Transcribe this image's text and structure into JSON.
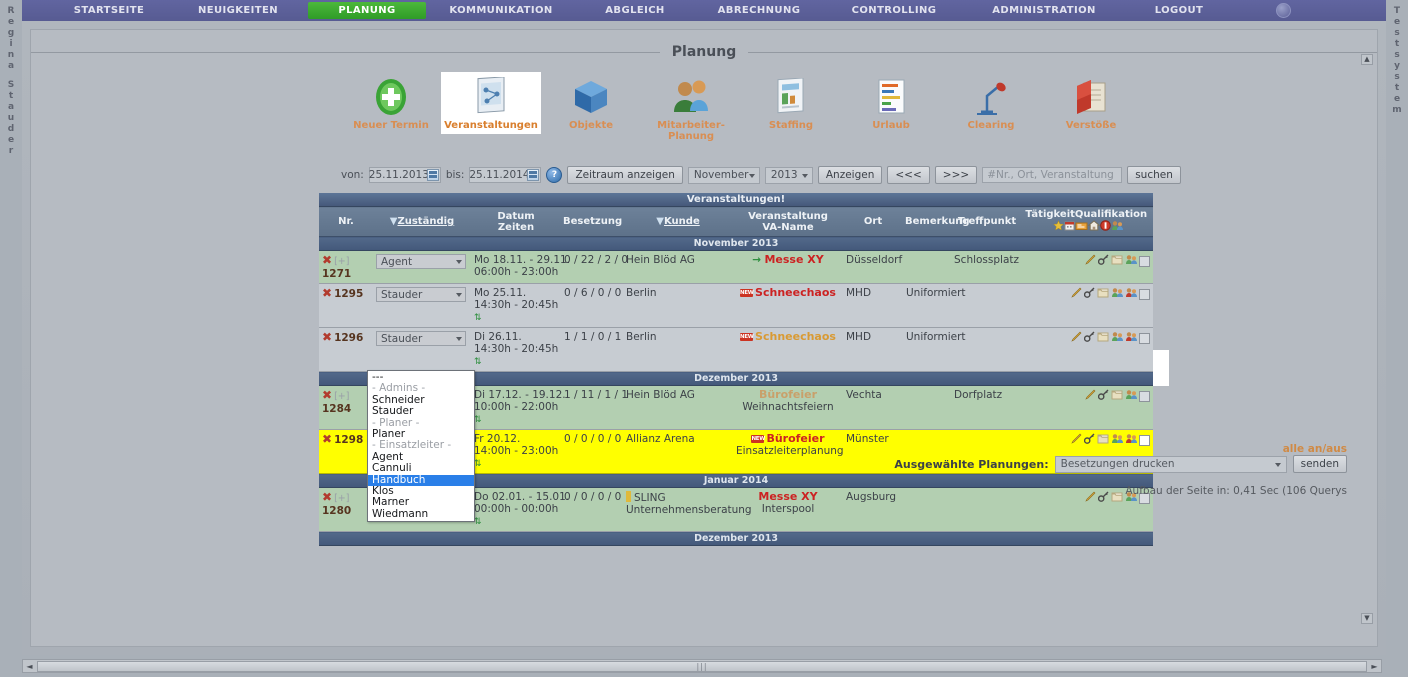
{
  "user_strip": "Regina Stauder",
  "system_strip": "Testsystem",
  "nav": {
    "items": [
      {
        "label": "STARTSEITE",
        "active": false
      },
      {
        "label": "NEUIGKEITEN",
        "active": false
      },
      {
        "label": "PLANUNG",
        "active": true
      },
      {
        "label": "KOMMUNIKATION",
        "active": false
      },
      {
        "label": "ABGLEICH",
        "active": false
      },
      {
        "label": "ABRECHNUNG",
        "active": false
      },
      {
        "label": "CONTROLLING",
        "active": false
      },
      {
        "label": "ADMINISTRATION",
        "active": false
      },
      {
        "label": "LOGOUT",
        "active": false
      }
    ]
  },
  "section": {
    "title": "Planung"
  },
  "toolbar": {
    "items": [
      {
        "label": "Neuer Termin",
        "icon": "green-plus-icon",
        "selected": false
      },
      {
        "label": "Veranstaltungen",
        "icon": "clipboard-chart-icon",
        "selected": true
      },
      {
        "label": "Objekte",
        "icon": "blue-cube-icon",
        "selected": false
      },
      {
        "label": "Mitarbeiter-Planung",
        "icon": "two-people-icon",
        "selected": false
      },
      {
        "label": "Staffing",
        "icon": "document-list-icon",
        "selected": false
      },
      {
        "label": "Urlaub",
        "icon": "gantt-bars-icon",
        "selected": false
      },
      {
        "label": "Clearing",
        "icon": "desk-lamp-icon",
        "selected": false
      },
      {
        "label": "Verstöße",
        "icon": "red-folder-icon",
        "selected": false
      }
    ]
  },
  "filters": {
    "von_label": "von:",
    "von_value": "25.11.2013",
    "bis_label": "bis:",
    "bis_value": "25.11.2014",
    "help_glyph": "?",
    "zeitraum_button": "Zeitraum anzeigen",
    "month_value": "November",
    "year_value": "2013",
    "anzeigen_button": "Anzeigen",
    "prev_button": "<<<",
    "next_button": ">>>",
    "search_placeholder": "#Nr., Ort, Veranstaltung",
    "search_value": "",
    "search_button": "suchen"
  },
  "table": {
    "title": "Veranstaltungen!",
    "columns": {
      "nr": "Nr.",
      "zustaendig": "Zuständig",
      "datum": "Datum",
      "zeiten": "Zeiten",
      "besetzung": "Besetzung",
      "kunde": "Kunde",
      "veranstaltung": "Veranstaltung",
      "va_name": "VA-Name",
      "ort": "Ort",
      "bemerkung": "Bemerkung",
      "treffpunkt": "Treffpunkt",
      "taetigkeit": "Tätigkeit",
      "qualifikation": "Qualifikation"
    },
    "header_icons": [
      "star-icon",
      "calendar-icon",
      "card-icon",
      "home-icon",
      "warning-icon",
      "people-icon"
    ],
    "groups": [
      {
        "month": "November 2013",
        "rows": [
          {
            "tone": "green",
            "expand": "[+]",
            "nr": "1271",
            "zustaendig": "Agent",
            "datum": "Mo 18.11. - 29.11.",
            "zeiten": "06:00h - 23:00h",
            "besetzung": "0 / 22 / 2 / 0",
            "kunde": "Hein Blöd AG",
            "veranstaltung": "Messe XY",
            "va_name": "",
            "va_color": "red",
            "badge": "arrow",
            "ort": "Düsseldorf",
            "bemerkung": "",
            "treffpunkt": "Schlossplatz",
            "recurring": false,
            "actions": [
              "pencil-icon",
              "key-icon",
              "folder-icon",
              "people-icon",
              "checkbox"
            ]
          },
          {
            "tone": "grey",
            "expand": "",
            "nr": "1295",
            "zustaendig": "Stauder",
            "datum": "Mo 25.11.",
            "zeiten": "14:30h - 20:45h",
            "besetzung": "0 / 6 / 0 / 0",
            "kunde": "Berlin",
            "veranstaltung": "Schneechaos",
            "va_name": "",
            "va_color": "red",
            "badge": "new",
            "ort": "MHD",
            "bemerkung": "Uniformiert",
            "treffpunkt": "",
            "recurring": true,
            "actions": [
              "pencil-icon",
              "key-icon",
              "folder-icon",
              "people-icon",
              "people2-icon",
              "checkbox"
            ]
          },
          {
            "tone": "grey",
            "expand": "",
            "nr": "1296",
            "zustaendig": "Stauder",
            "datum": "Di 26.11.",
            "zeiten": "14:30h - 20:45h",
            "besetzung": "1 / 1 / 0 / 1",
            "kunde": "Berlin",
            "veranstaltung": "Schneechaos",
            "va_name": "",
            "va_color": "orange",
            "badge": "new",
            "ort": "MHD",
            "bemerkung": "Uniformiert",
            "treffpunkt": "",
            "recurring": true,
            "actions": [
              "pencil-icon",
              "key-icon",
              "folder-icon",
              "people-icon",
              "people2-icon",
              "checkbox"
            ]
          }
        ]
      },
      {
        "month": "Dezember 2013",
        "rows": [
          {
            "tone": "green",
            "expand": "[+]",
            "nr": "1284",
            "zustaendig": "Stauder",
            "datum": "Di 17.12. - 19.12.",
            "zeiten": "10:00h - 22:00h",
            "besetzung": "1 / 11 / 1 / 1",
            "kunde": "Hein Blöd AG",
            "veranstaltung": "Bürofeier",
            "va_name": "Weihnachtsfeiern",
            "va_color": "tan",
            "badge": "",
            "ort": "Vechta",
            "bemerkung": "",
            "treffpunkt": "Dorfplatz",
            "recurring": true,
            "actions": [
              "pencil-icon",
              "key-icon",
              "folder-icon",
              "people-icon",
              "checkbox"
            ]
          },
          {
            "tone": "yellow",
            "expand": "",
            "nr": "1298",
            "zustaendig": "Handbuch",
            "datum": "Fr 20.12.",
            "zeiten": "14:00h - 23:00h",
            "besetzung": "0 / 0 / 0 / 0",
            "kunde": "Allianz Arena",
            "veranstaltung": "Bürofeier",
            "va_name": "Einsatzleiterplanung",
            "va_color": "red",
            "badge": "new",
            "ort": "Münster",
            "bemerkung": "",
            "treffpunkt": "",
            "recurring": true,
            "actions": [
              "pencil-icon",
              "key-icon",
              "folder-icon",
              "people-icon",
              "people2-icon",
              "checkbox"
            ]
          }
        ]
      },
      {
        "month": "Januar 2014",
        "rows": [
          {
            "tone": "green",
            "expand": "[+]",
            "nr": "1280",
            "zustaendig": "",
            "datum": "Do 02.01. - 15.01.",
            "zeiten": "00:00h - 00:00h",
            "besetzung": "0 / 0 / 0 / 0",
            "kunde": "SLING Unternehmensberatung",
            "veranstaltung": "Messe XY",
            "va_name": "Interspool",
            "va_color": "red",
            "badge": "ybar",
            "ort": "Augsburg",
            "bemerkung": "",
            "treffpunkt": "",
            "recurring": true,
            "actions": [
              "pencil-icon",
              "key-icon",
              "folder-icon",
              "people-icon",
              "checkbox"
            ]
          }
        ]
      }
    ],
    "footer_month": "Dezember 2013"
  },
  "dropdown": {
    "selected": "Handbuch",
    "options": [
      {
        "label": "---",
        "group": false,
        "selected": false
      },
      {
        "label": "- Admins -",
        "group": true,
        "selected": false
      },
      {
        "label": "Schneider",
        "group": false,
        "selected": false
      },
      {
        "label": "Stauder",
        "group": false,
        "selected": false
      },
      {
        "label": "- Planer -",
        "group": true,
        "selected": false
      },
      {
        "label": "Planer",
        "group": false,
        "selected": false
      },
      {
        "label": "- Einsatzleiter -",
        "group": true,
        "selected": false
      },
      {
        "label": "Agent",
        "group": false,
        "selected": false
      },
      {
        "label": "Cannuli",
        "group": false,
        "selected": false
      },
      {
        "label": "Handbuch",
        "group": false,
        "selected": true
      },
      {
        "label": "Klos",
        "group": false,
        "selected": false
      },
      {
        "label": "Marner",
        "group": false,
        "selected": false
      },
      {
        "label": "Wiedmann",
        "group": false,
        "selected": false
      }
    ]
  },
  "bottom": {
    "all_toggle": "alle an/aus",
    "selected_label": "Ausgewählte Planungen:",
    "action_value": "Besetzungen drucken",
    "send_button": "senden",
    "build_info": "Aufbau der Seite in: 0,41 Sec (106 Querys"
  },
  "scroll": {
    "thumb_grip": "|||",
    "left_arrow": "◄",
    "right_arrow": "►",
    "up_arrow": "▲",
    "down_arrow": "▼"
  }
}
